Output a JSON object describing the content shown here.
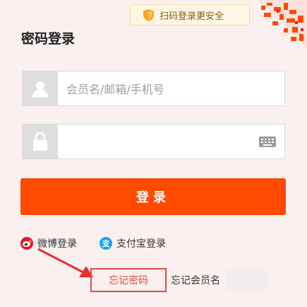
{
  "qr_tip": {
    "text": "扫码登录更安全"
  },
  "title": "密码登录",
  "username": {
    "placeholder": "会员名/邮箱/手机号"
  },
  "password": {
    "placeholder": ""
  },
  "login_button": {
    "label": "登录"
  },
  "alt_logins": [
    {
      "label": "微博登录",
      "icon": "weibo-icon"
    },
    {
      "label": "支付宝登录",
      "icon": "alipay-icon"
    }
  ],
  "links": {
    "forgot_password": "忘记密码",
    "forgot_username": "忘记会员名"
  },
  "colors": {
    "accent": "#ff4a00",
    "highlight": "#e8483c",
    "alipay": "#1ea3e8",
    "weibo": "#e6162d"
  }
}
